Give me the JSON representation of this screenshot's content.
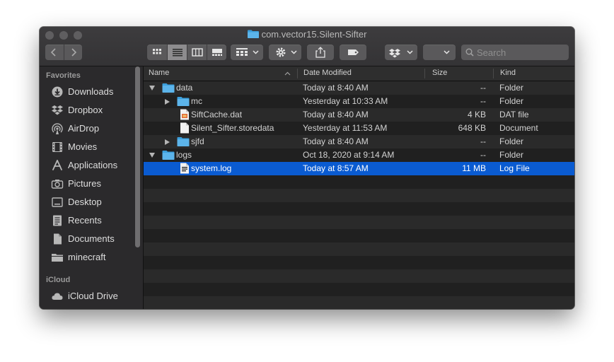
{
  "window": {
    "title": "com.vector15.Silent-Sifter"
  },
  "toolbar": {
    "back": "back",
    "forward": "forward",
    "views": [
      "icon-view",
      "list-view",
      "column-view",
      "gallery-view"
    ],
    "selected_view": "list-view",
    "group": "group-by",
    "action": "action-gear",
    "share": "share",
    "tags": "tags",
    "dropbox": "dropbox",
    "search_placeholder": "Search"
  },
  "sidebar": {
    "favorites_heading": "Favorites",
    "favorites": [
      {
        "label": "Downloads",
        "icon": "download-icon"
      },
      {
        "label": "Dropbox",
        "icon": "dropbox-icon"
      },
      {
        "label": "AirDrop",
        "icon": "airdrop-icon"
      },
      {
        "label": "Movies",
        "icon": "film-icon"
      },
      {
        "label": "Applications",
        "icon": "applications-icon"
      },
      {
        "label": "Pictures",
        "icon": "camera-icon"
      },
      {
        "label": "Desktop",
        "icon": "desktop-icon"
      },
      {
        "label": "Recents",
        "icon": "recents-icon"
      },
      {
        "label": "Documents",
        "icon": "document-icon"
      },
      {
        "label": "minecraft",
        "icon": "folder-icon"
      }
    ],
    "icloud_heading": "iCloud",
    "icloud": [
      {
        "label": "iCloud Drive",
        "icon": "cloud-icon"
      }
    ]
  },
  "columns": {
    "name": "Name",
    "date": "Date Modified",
    "size": "Size",
    "kind": "Kind"
  },
  "files": [
    {
      "name": "data",
      "date": "Today at 8:40 AM",
      "size": "--",
      "kind": "Folder",
      "type": "folder",
      "disclosure": "open",
      "indent": 0
    },
    {
      "name": "mc",
      "date": "Yesterday at 10:33 AM",
      "size": "--",
      "kind": "Folder",
      "type": "folder",
      "disclosure": "closed",
      "indent": 1
    },
    {
      "name": "SiftCache.dat",
      "date": "Today at 8:40 AM",
      "size": "4 KB",
      "kind": "DAT file",
      "type": "dat",
      "disclosure": "",
      "indent": 1
    },
    {
      "name": "Silent_Sifter.storedata",
      "date": "Yesterday at 11:53 AM",
      "size": "648 KB",
      "kind": "Document",
      "type": "doc",
      "disclosure": "",
      "indent": 1
    },
    {
      "name": "sjfd",
      "date": "Today at 8:40 AM",
      "size": "--",
      "kind": "Folder",
      "type": "folder",
      "disclosure": "closed",
      "indent": 1
    },
    {
      "name": "logs",
      "date": "Oct 18, 2020 at 9:14 AM",
      "size": "--",
      "kind": "Folder",
      "type": "folder",
      "disclosure": "open",
      "indent": 0
    },
    {
      "name": "system.log",
      "date": "Today at 8:57 AM",
      "size": "11 MB",
      "kind": "Log File",
      "type": "log",
      "disclosure": "",
      "indent": 1,
      "selected": true
    }
  ],
  "colors": {
    "selection": "#0a5bd1",
    "folder": "#3b9fdc",
    "window_bg": "#1e1e1e"
  }
}
